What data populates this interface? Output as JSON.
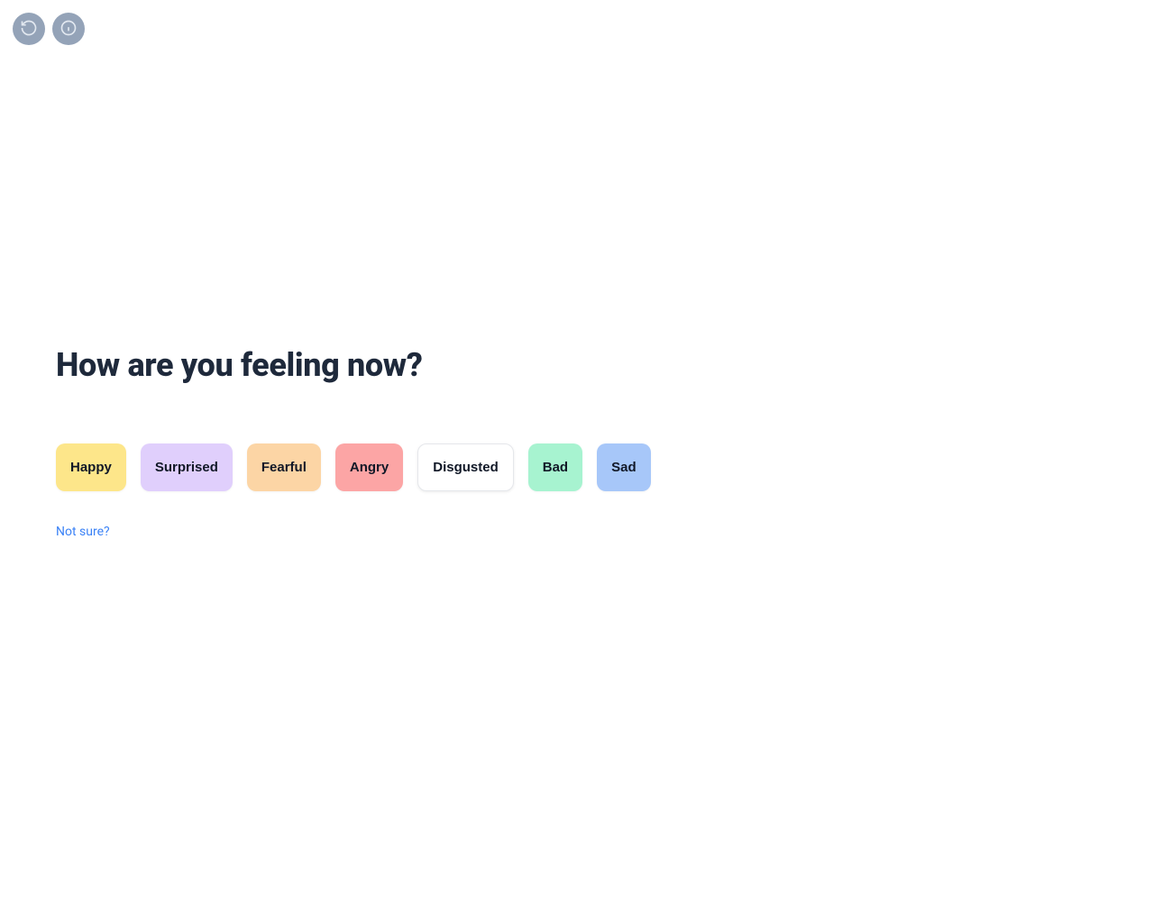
{
  "header": {
    "reset_icon": "rotate-ccw-icon",
    "info_icon": "info-icon"
  },
  "main": {
    "heading": "How are you feeling now?",
    "emotions": [
      {
        "label": "Happy",
        "color_class": "c-happy"
      },
      {
        "label": "Surprised",
        "color_class": "c-surprised"
      },
      {
        "label": "Fearful",
        "color_class": "c-fearful"
      },
      {
        "label": "Angry",
        "color_class": "c-angry"
      },
      {
        "label": "Disgusted",
        "color_class": "c-disgusted"
      },
      {
        "label": "Bad",
        "color_class": "c-bad"
      },
      {
        "label": "Sad",
        "color_class": "c-sad"
      }
    ],
    "not_sure_label": "Not sure?"
  },
  "colors": {
    "happy": "#fde68a",
    "surprised": "#e0cffc",
    "fearful": "#fcd5a5",
    "angry": "#fca5a5",
    "disgusted": "#ffffff",
    "bad": "#a7f3d0",
    "sad": "#a7c7f9",
    "link": "#3b82f6",
    "heading": "#1e293b"
  }
}
